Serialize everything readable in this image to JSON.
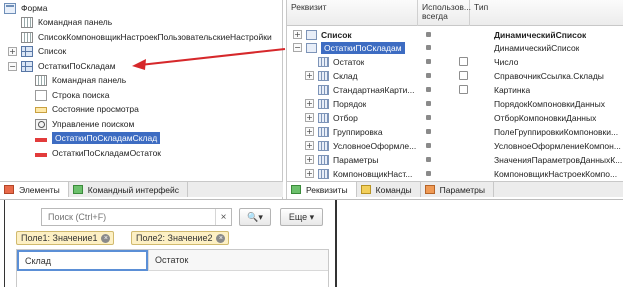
{
  "elements_tree": {
    "items": [
      {
        "label": "Форма",
        "toggle": "",
        "icon": "form-icon"
      },
      {
        "label": "Командная панель",
        "toggle": "",
        "icon": "command-panel-icon"
      },
      {
        "label": "СписокКомпоновщикНастроекПользовательскиеНастройки",
        "toggle": "",
        "icon": "group-icon"
      },
      {
        "label": "Список",
        "toggle": "+",
        "icon": "table-icon"
      },
      {
        "label": "ОстаткиПоСкладам",
        "toggle": "−",
        "icon": "table-icon"
      },
      {
        "label": "Командная панель",
        "toggle": "",
        "icon": "command-panel-icon"
      },
      {
        "label": "Строка поиска",
        "toggle": "",
        "icon": "field-icon"
      },
      {
        "label": "Состояние просмотра",
        "toggle": "",
        "icon": "status-icon"
      },
      {
        "label": "Управление поиском",
        "toggle": "",
        "icon": "search-control-icon"
      },
      {
        "label": "ОстаткиПоСкладамСклад",
        "toggle": "",
        "icon": "field-red-icon",
        "selected": true
      },
      {
        "label": "ОстаткиПоСкладамОстаток",
        "toggle": "",
        "icon": "field-red-icon"
      }
    ],
    "tabs": [
      {
        "label": "Элементы",
        "icon": "elements-tab-icon"
      },
      {
        "label": "Командный интерфейс",
        "icon": "command-interface-tab-icon"
      }
    ]
  },
  "attributes_grid": {
    "headers": {
      "name": "Реквизит",
      "use_always": "Использов... всегда",
      "type": "Тип"
    },
    "rows": [
      {
        "name": "Список",
        "type": "ДинамическийСписок",
        "bold": true,
        "toggle": "+",
        "level": 0,
        "checkbox": false
      },
      {
        "name": "ОстаткиПоСкладам",
        "type": "ДинамическийСписок",
        "toggle": "−",
        "level": 0,
        "checkbox": false,
        "selected": true
      },
      {
        "name": "Остаток",
        "type": "Число",
        "toggle": "",
        "level": 1,
        "checkbox": true
      },
      {
        "name": "Склад",
        "type": "СправочникСсылка.Склады",
        "toggle": "+",
        "level": 1,
        "checkbox": true
      },
      {
        "name": "СтандартнаяКарти...",
        "type": "Картинка",
        "toggle": "",
        "level": 1,
        "checkbox": true
      },
      {
        "name": "Порядок",
        "type": "ПорядокКомпоновкиДанных",
        "toggle": "+",
        "level": 1,
        "checkbox": false
      },
      {
        "name": "Отбор",
        "type": "ОтборКомпоновкиДанных",
        "toggle": "+",
        "level": 1,
        "checkbox": false
      },
      {
        "name": "Группировка",
        "type": "ПолеГруппировкиКомпоновки...",
        "toggle": "+",
        "level": 1,
        "checkbox": false
      },
      {
        "name": "УсловноеОформле...",
        "type": "УсловноеОформлениеКомпон...",
        "toggle": "+",
        "level": 1,
        "checkbox": false
      },
      {
        "name": "Параметры",
        "type": "ЗначенияПараметровДанныхК...",
        "toggle": "+",
        "level": 1,
        "checkbox": false
      },
      {
        "name": "КомпоновщикНаст...",
        "type": "КомпоновщикНастроекКомпо...",
        "toggle": "+",
        "level": 1,
        "checkbox": false
      }
    ],
    "tabs": [
      {
        "label": "Реквизиты",
        "icon": "attributes-tab-icon"
      },
      {
        "label": "Команды",
        "icon": "commands-tab-icon"
      },
      {
        "label": "Параметры",
        "icon": "parameters-tab-icon"
      }
    ]
  },
  "preview": {
    "search_placeholder": "Поиск (Ctrl+F)",
    "clear_glyph": "×",
    "search_button_glyph": "🔍▾",
    "more_button": "Еще ▾",
    "filters": [
      {
        "label": "Поле1: Значение1"
      },
      {
        "label": "Поле2: Значение2"
      }
    ],
    "columns": [
      "Склад",
      "Остаток"
    ]
  },
  "colors": {
    "selection": "#3d6cc2",
    "arrow": "#d6282b",
    "filter_chip": "#fdf0c4"
  }
}
